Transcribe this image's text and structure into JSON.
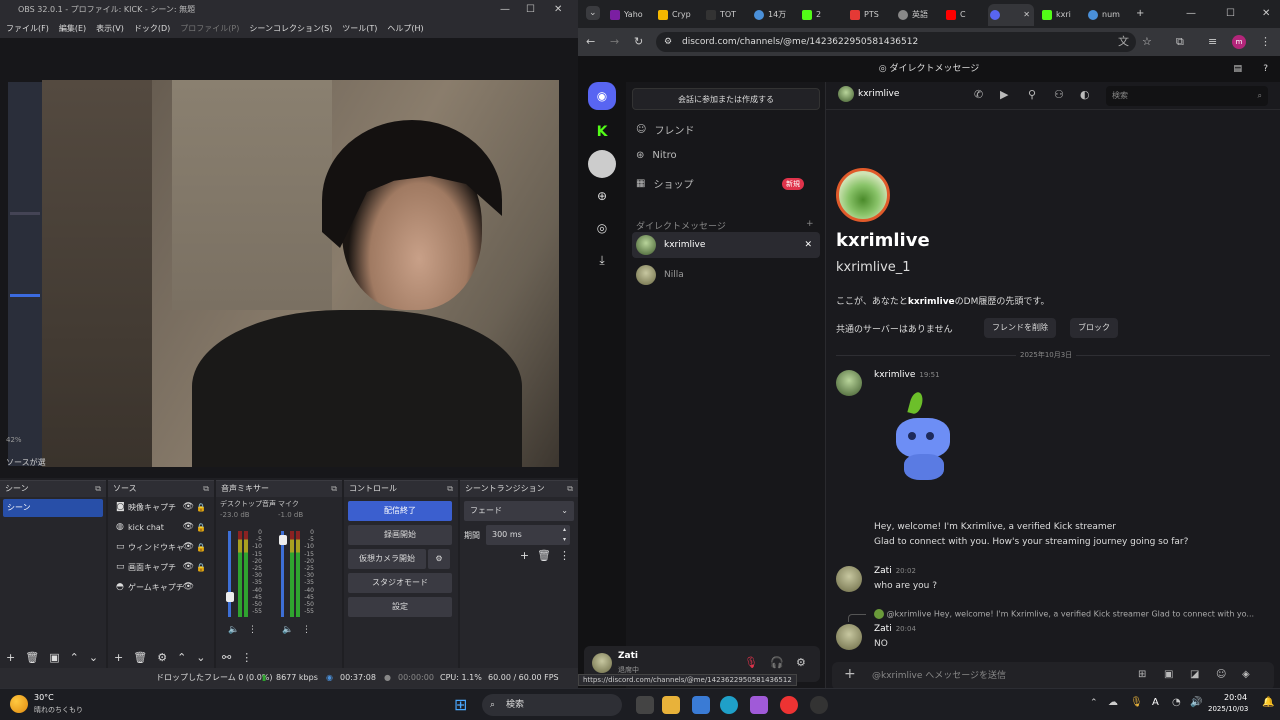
{
  "obs": {
    "title": "OBS 32.0.1 - プロファイル: KICK - シーン: 無題",
    "menu": [
      "ファイル(F)",
      "編集(E)",
      "表示(V)",
      "ドック(D)",
      "プロファイル(P)",
      "シーンコレクション(S)",
      "ツール(T)",
      "ヘルプ(H)"
    ],
    "zoom": "42%",
    "source_note": "ソースが選",
    "docks": {
      "scene": {
        "title": "シーン",
        "items": [
          "シーン"
        ]
      },
      "source": {
        "title": "ソース",
        "items": [
          {
            "icon": "camera-icon",
            "label": "映像キャプチ"
          },
          {
            "icon": "browser-icon",
            "label": "kick chat"
          },
          {
            "icon": "window-icon",
            "label": "ウィンドウキャ"
          },
          {
            "icon": "display-icon",
            "label": "画面キャプチ"
          },
          {
            "icon": "gamepad-icon",
            "label": "ゲームキャプチ"
          }
        ]
      },
      "mixer": {
        "title": "音声ミキサー",
        "channels": [
          {
            "name": "デスクトップ音声",
            "db": "-23.0 dB",
            "level": 0.35
          },
          {
            "name": "マイク",
            "db": "-1.0 dB",
            "level": 0.85
          }
        ],
        "scale": [
          "0",
          "-5",
          "-10",
          "-15",
          "-20",
          "-25",
          "-30",
          "-35",
          "-40",
          "-45",
          "-50",
          "-55",
          "-60"
        ]
      },
      "controls": {
        "title": "コントロール",
        "buttons": [
          "配信終了",
          "録画開始",
          "仮想カメラ開始",
          "スタジオモード",
          "設定"
        ]
      },
      "transitions": {
        "title": "シーントランジション",
        "type": "フェード",
        "duration_label": "期間",
        "duration": "300 ms"
      }
    },
    "status": {
      "dropped": "ドロップしたフレーム 0 (0.0%)",
      "kbps": "8677 kbps",
      "stream_time": "00:37:08",
      "rec_time": "00:00:00",
      "cpu": "CPU: 1.1%",
      "fps": "60.00 / 60.00 FPS"
    }
  },
  "browser": {
    "tabs": [
      {
        "label": "Yaho",
        "color": "#7b1fa2"
      },
      {
        "label": "Cryp",
        "color": "#f5b800"
      },
      {
        "label": "TOT",
        "color": "#222"
      },
      {
        "label": "14万",
        "color": "#4a90d9"
      },
      {
        "label": "2",
        "color": "#53fc18"
      },
      {
        "label": "PTS",
        "color": "#e53935"
      },
      {
        "label": "英語",
        "color": "#888"
      },
      {
        "label": "C",
        "color": "#ff0000"
      },
      {
        "label": "",
        "color": "#5865f2"
      },
      {
        "label": "kxri",
        "color": "#53fc18"
      },
      {
        "label": "num",
        "color": "#4a90d9"
      }
    ],
    "url": "discord.com/channels/@me/1423622950581436512",
    "hover_url": "https://discord.com/channels/@me/1423622950581436512"
  },
  "discord": {
    "topbar": "ダイレクトメッセージ",
    "find_button": "会話に参加または作成する",
    "nav": [
      {
        "icon": "friends-icon",
        "label": "フレンド"
      },
      {
        "icon": "nitro-icon",
        "label": "Nitro"
      },
      {
        "icon": "shop-icon",
        "label": "ショップ",
        "badge": "新規"
      }
    ],
    "dm_header": "ダイレクトメッセージ",
    "dms": [
      {
        "name": "kxrimlive",
        "active": true
      },
      {
        "name": "Nilla",
        "active": false
      }
    ],
    "user": {
      "name": "Zati",
      "status": "退席中"
    },
    "chat": {
      "header_name": "kxrimlive",
      "search_placeholder": "検索",
      "profile_name": "kxrimlive",
      "profile_handle": "kxrimlive_1",
      "intro_prefix": "ここが、あなたと",
      "intro_name": "kxrimlive",
      "intro_suffix": "のDM履歴の先頭です。",
      "no_servers": "共通のサーバーはありません",
      "remove_friend": "フレンドを削除",
      "block": "ブロック",
      "date_divider": "2025年10月3日",
      "messages": [
        {
          "author": "kxrimlive",
          "time": "19:51",
          "lines": [
            "Hey, welcome! I'm Kxrimlive, a verified Kick streamer",
            "Glad to connect with you. How's your streaming journey going so far?"
          ]
        },
        {
          "author": "Zati",
          "time": "20:02",
          "lines": [
            "who are you ?"
          ]
        },
        {
          "author": "Zati",
          "time": "20:04",
          "reply_to": "@kxrimlive Hey, welcome! I'm Kxrimlive, a verified Kick streamer  Glad to connect with yo...",
          "lines": [
            "NO"
          ]
        }
      ],
      "composer_placeholder": "@kxrimlive へメッセージを送信"
    }
  },
  "taskbar": {
    "weather_temp": "30°C",
    "weather_text": "晴れのちくもり",
    "search": "検索",
    "time": "20:04",
    "date": "2025/10/03",
    "ime": "A"
  }
}
